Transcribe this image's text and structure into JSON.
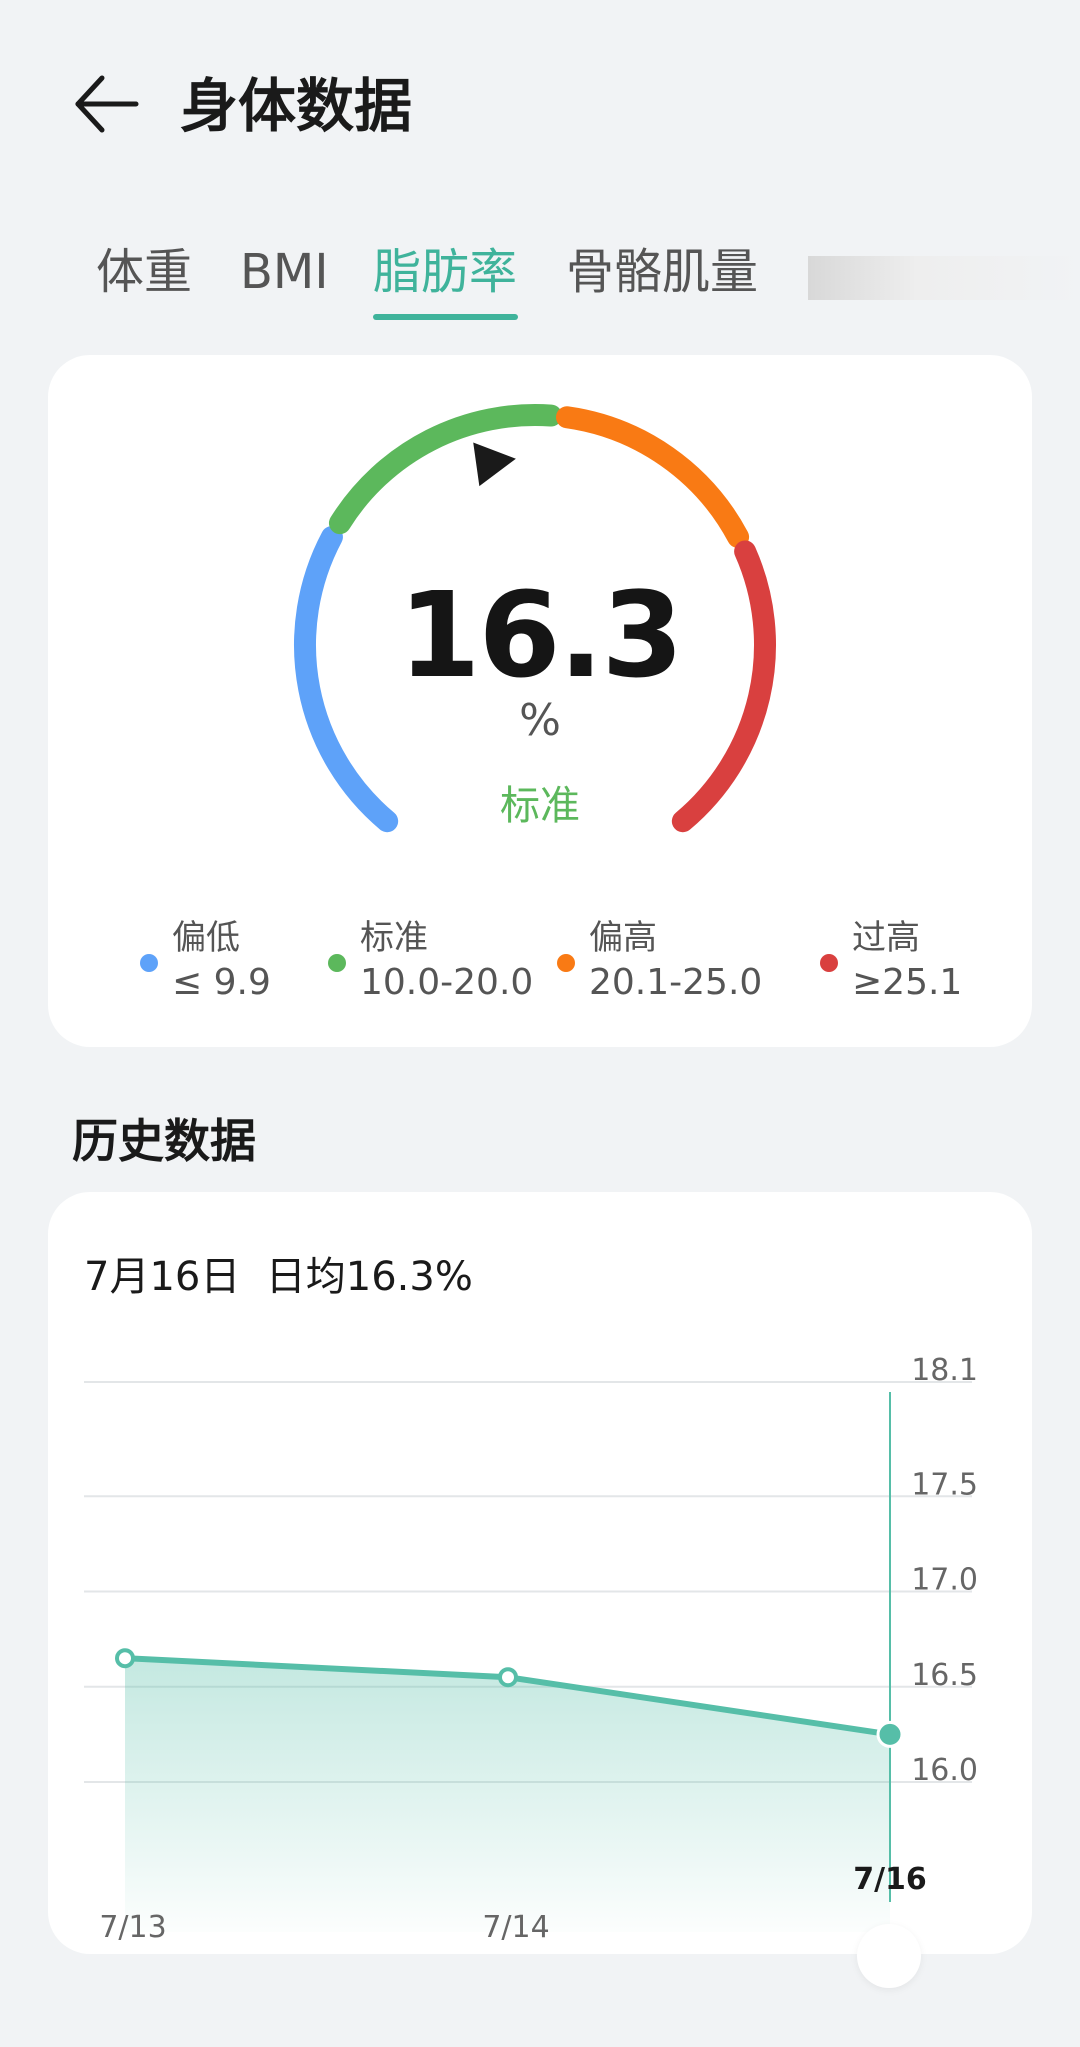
{
  "header": {
    "title": "身体数据"
  },
  "tabs": [
    {
      "label": "体重",
      "active": false
    },
    {
      "label": "BMI",
      "active": false
    },
    {
      "label": "脂肪率",
      "active": true
    },
    {
      "label": "骨骼肌量",
      "active": false
    }
  ],
  "gauge": {
    "value": "16.3",
    "value_number": 16.3,
    "unit": "%",
    "status": "标准",
    "segments": [
      {
        "label": "偏低",
        "range": "≤ 9.9",
        "color": "#5ea2f9"
      },
      {
        "label": "标准",
        "range": "10.0-20.0",
        "color": "#5cb85c"
      },
      {
        "label": "偏高",
        "range": "20.1-25.0",
        "color": "#f97a14"
      },
      {
        "label": "过高",
        "range": "≥25.1",
        "color": "#d9403f"
      }
    ]
  },
  "history": {
    "section_title": "历史数据",
    "summary": "7月16日  日均16.3%"
  },
  "chart_data": {
    "type": "area",
    "x": [
      "7/13",
      "7/14",
      "7/16"
    ],
    "series": [
      {
        "values": [
          16.65,
          16.55,
          16.25
        ]
      }
    ],
    "y_ticks": [
      "18.1",
      "17.5",
      "17.0",
      "16.5",
      "16.0"
    ],
    "ylim": [
      16.0,
      18.1
    ],
    "selected": "7/16",
    "grid": true,
    "line_color": "#56bea8"
  }
}
